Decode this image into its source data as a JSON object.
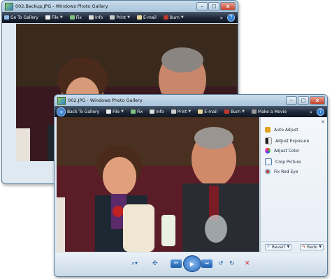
{
  "back_window": {
    "title": "002.Backup.JPG - Windows Photo Gallery",
    "toolbar": {
      "go_to_gallery": "Go To Gallery",
      "file": "File",
      "fix": "Fix",
      "info": "Info",
      "print": "Print",
      "email": "E-mail",
      "burn": "Burn",
      "more": "»",
      "help": "?"
    }
  },
  "front_window": {
    "title": "002.JPG - Windows Photo Gallery",
    "toolbar": {
      "back_to_gallery": "Back To Gallery",
      "file": "File",
      "fix": "Fix",
      "info": "Info",
      "print": "Print",
      "email": "E-mail",
      "burn": "Burn",
      "make_movie": "Make a Movie",
      "more": "»",
      "help": "?"
    },
    "fix_pane": {
      "items": [
        {
          "label": "Auto Adjust",
          "icon": "wand-icon",
          "color": "#e0a020"
        },
        {
          "label": "Adjust Exposure",
          "icon": "exposure-icon",
          "color": "#222222"
        },
        {
          "label": "Adjust Color",
          "icon": "color-icon",
          "color": "#c040c0"
        },
        {
          "label": "Crop Picture",
          "icon": "crop-icon",
          "color": "#4a7ab0"
        },
        {
          "label": "Fix Red Eye",
          "icon": "eye-icon",
          "color": "#4a6a90"
        }
      ],
      "revert": "Revert",
      "redo": "Redo"
    },
    "controls": {
      "zoom": "⌕",
      "fit": "✣",
      "prev": "⏮",
      "play": "▶",
      "next": "⏭",
      "rotate_ccw": "↺",
      "rotate_cw": "↻",
      "delete": "✕"
    }
  }
}
